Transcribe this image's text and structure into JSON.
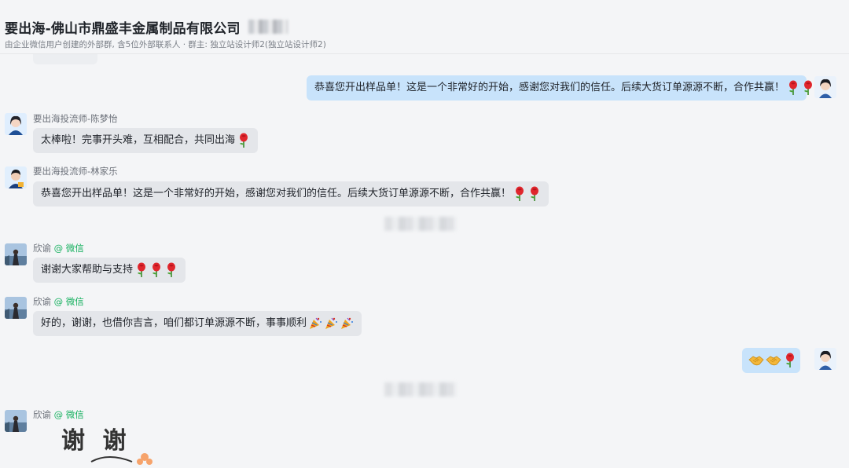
{
  "header": {
    "title": "要出海-佛山市鼎盛丰金属制品有限公司",
    "subtitle": "由企业微信用户创建的外部群, 含5位外部联系人 · 群主: 独立站设计师2(独立站设计师2)"
  },
  "messages": [
    {
      "direction": "out",
      "text": "恭喜您开出样品单！这是一个非常好的开始，感谢您对我们的信任。后续大货订单源源不断，合作共赢！",
      "emoji": [
        "rose-icon",
        "rose-icon"
      ]
    },
    {
      "direction": "in",
      "sender": "要出海投流师-陈梦怡",
      "text": "太棒啦！完事开头难，互相配合，共同出海",
      "emoji": [
        "rose-icon"
      ]
    },
    {
      "direction": "in",
      "sender": "要出海投流师-林家乐",
      "text": "恭喜您开出样品单！这是一个非常好的开始，感谢您对我们的信任。后续大货订单源源不断，合作共赢！",
      "emoji": [
        "rose-icon",
        "rose-icon"
      ]
    },
    {
      "direction": "in",
      "sender": "欣谕",
      "sender_tag": "@ 微信",
      "text": "谢谢大家帮助与支持",
      "emoji": [
        "rose-icon",
        "rose-icon",
        "rose-icon"
      ]
    },
    {
      "direction": "in",
      "sender": "欣谕",
      "sender_tag": "@ 微信",
      "text": "好的，谢谢，也借你吉言，咱们都订单源源不断，事事顺利",
      "emoji": [
        "party-icon",
        "party-icon",
        "party-icon"
      ]
    },
    {
      "direction": "out",
      "text": "",
      "emoji": [
        "handshake-icon",
        "handshake-icon",
        "rose-icon"
      ]
    },
    {
      "direction": "in",
      "sender": "欣谕",
      "sender_tag": "@ 微信",
      "sticker": "谢 谢",
      "emoji": []
    }
  ],
  "colors": {
    "outgoing_bubble": "#c8e3fb",
    "incoming_bubble": "#e4e6ea",
    "wechat_tag": "#16b05f"
  }
}
